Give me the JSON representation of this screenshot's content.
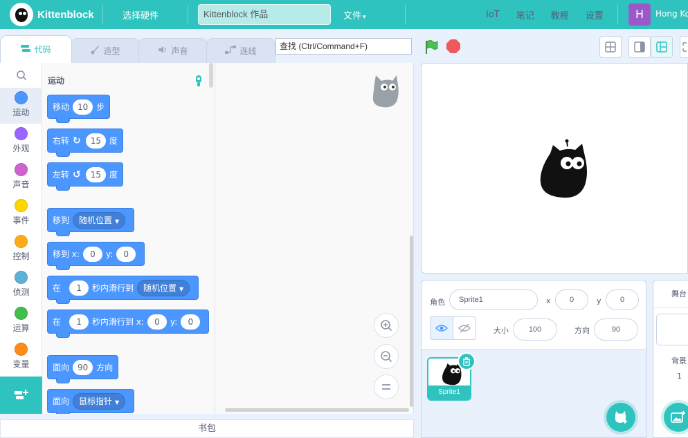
{
  "app": {
    "name": "Kittenblock"
  },
  "topbar": {
    "select_hardware": "选择硬件",
    "project_title": "Kittenblock 作品",
    "file_menu": "文件",
    "file_caret": "▾",
    "iot": "IoT",
    "notes": "笔记",
    "tutorials": "教程",
    "settings": "设置",
    "user_initial": "H",
    "user_name": "Hong Ko"
  },
  "tabs": [
    {
      "label": "代码",
      "active": true
    },
    {
      "label": "造型",
      "active": false
    },
    {
      "label": "声音",
      "active": false
    },
    {
      "label": "连线",
      "active": false
    }
  ],
  "search": {
    "placeholder": "查找 (Ctrl/Command+F)"
  },
  "categories": [
    {
      "label": "运动",
      "color": "#4c97ff"
    },
    {
      "label": "外观",
      "color": "#9966ff"
    },
    {
      "label": "声音",
      "color": "#cf63cf"
    },
    {
      "label": "事件",
      "color": "#ffd500"
    },
    {
      "label": "控制",
      "color": "#ffab19"
    },
    {
      "label": "侦测",
      "color": "#5cb1d6"
    },
    {
      "label": "运算",
      "color": "#40bf4a"
    },
    {
      "label": "变量",
      "color": "#ff8c1a"
    }
  ],
  "palette": {
    "title": "运动",
    "blocks": {
      "move": {
        "pre": "移动",
        "value": "10",
        "post": "步"
      },
      "turn_right": {
        "pre": "右转",
        "value": "15",
        "post": "度"
      },
      "turn_left": {
        "pre": "左转",
        "value": "15",
        "post": "度"
      },
      "goto": {
        "pre": "移到",
        "option": "随机位置"
      },
      "goto_xy": {
        "pre": "移到 x:",
        "x": "0",
        "y_label": "y:",
        "y": "0"
      },
      "glide": {
        "pre": "在",
        "secs": "1",
        "mid": "秒内滑行到",
        "option": "随机位置"
      },
      "glide_xy": {
        "pre": "在",
        "secs": "1",
        "mid": "秒内滑行到 x:",
        "x": "0",
        "y_label": "y:",
        "y": "0"
      },
      "point_dir": {
        "pre": "面向",
        "value": "90",
        "post": "方向"
      },
      "point_towards": {
        "pre": "面向",
        "option": "鼠标指针"
      }
    }
  },
  "backpack": {
    "label": "书包"
  },
  "sprite_info": {
    "sprite_label": "角色",
    "sprite_name": "Sprite1",
    "x_label": "x",
    "x": "0",
    "y_label": "y",
    "y": "0",
    "size_label": "大小",
    "size": "100",
    "direction_label": "方向",
    "direction": "90"
  },
  "sprites": [
    {
      "name": "Sprite1",
      "selected": true
    }
  ],
  "stage_pane": {
    "header": "舞台",
    "backdrop_label": "背景",
    "backdrop_count": "1"
  },
  "colors": {
    "accent": "#2fc3c0",
    "motion": "#4c97ff"
  }
}
